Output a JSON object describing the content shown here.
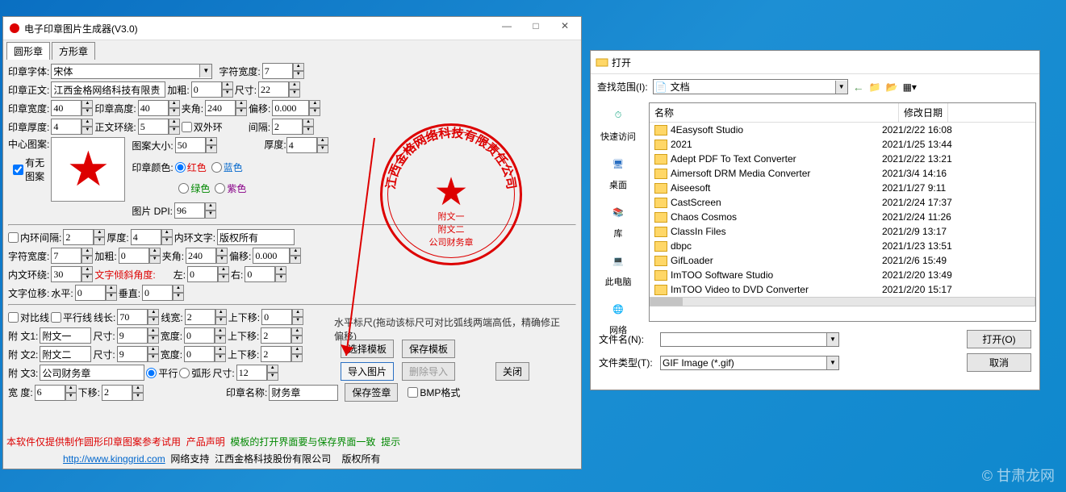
{
  "main": {
    "title": "电子印章图片生成器(V3.0)",
    "tabs": [
      "圆形章",
      "方形章"
    ],
    "font_label": "印章字体:",
    "font": "宋体",
    "charw_label": "字符宽度:",
    "charw": "7",
    "body_label": "印章正文:",
    "body": "江西金格网络科技有限责",
    "bold_label": "加粗:",
    "bold": "0",
    "size_label": "尺寸:",
    "size": "22",
    "w_label": "印章宽度:",
    "w": "40",
    "h_label": "印章高度:",
    "h": "40",
    "angle_label": "夹角:",
    "angle": "240",
    "offset_label": "偏移:",
    "offset": "0.000",
    "thick_label": "印章厚度:",
    "thick": "4",
    "ring_label": "正文环绕:",
    "ring": "5",
    "double_ring": "双外环",
    "gap_label": "间隔:",
    "gap": "2",
    "center_label": "中心图案:",
    "haspat_label": "有无\n图案",
    "pat_size_label": "图案大小:",
    "pat_size": "50",
    "color_label": "印章颜色:",
    "c_red": "红色",
    "c_blue": "蓝色",
    "c_green": "绿色",
    "c_purple": "紫色",
    "dpi_label": "图片 DPI:",
    "dpi": "96",
    "thick2_label": "厚度:",
    "thick2": "4",
    "inner_gap_chk": "内环间隔:",
    "inner_gap": "2",
    "inner_th_label": "厚度:",
    "inner_th": "4",
    "inner_txt_label": "内环文字:",
    "inner_txt": "版权所有",
    "cw_label": "字符宽度:",
    "cw": "7",
    "bold2": "0",
    "angle2": "240",
    "off2": "0.000",
    "iring_label": "内文环绕:",
    "iring": "30",
    "slant_label": "文字倾斜角度:",
    "left_label": "左:",
    "left": "0",
    "right_label": "右:",
    "right": "0",
    "shift_label": "文字位移:",
    "hlabel": "水平:",
    "hv": "0",
    "vlabel": "垂直:",
    "vv": "0",
    "diag": "对比线",
    "para": "平行线",
    "linelen_label": "线长:",
    "linelen": "70",
    "linew_label": "线宽:",
    "linew": "2",
    "up_label": "上下移:",
    "up": "0",
    "a1_label": "附 文1:",
    "a1": "附文一",
    "a1s": "9",
    "a1w": "0",
    "a1u": "2",
    "a2_label": "附 文2:",
    "a2": "附文二",
    "a2s": "9",
    "a2w": "0",
    "a2u": "2",
    "a3_label": "附 文3:",
    "a3": "公司财务章",
    "flat": "平行",
    "arc": "弧形",
    "a3s": "12",
    "deg_label": "宽   度:",
    "deg": "6",
    "down_label": "下移:",
    "down": "2",
    "stamp_name_label": "印章名称:",
    "stamp_name": "财务章",
    "btn_tpl": "选择模板",
    "btn_save_tpl": "保存模板",
    "btn_import": "导入图片",
    "btn_del": "删除导入",
    "btn_close": "关闭",
    "btn_save": "保存签章",
    "bmp_chk": "BMP格式",
    "ruler": "水平标尺(拖动该标尺可对比弧线两端高低，精确修正偏移)",
    "foot1": "本软件仅提供制作圆形印章图案参考试用",
    "foot2": "产品声明",
    "foot3": "模板的打开界面要与保存界面一致",
    "foot4": "提示",
    "foot_url": "http://www.kinggrid.com",
    "foot5": "网络支持",
    "foot6": "江西金格科技股份有限公司",
    "foot7": "版权所有",
    "seal_arc": "江西金格网络科技有限责任公司",
    "seal_l1": "附文一",
    "seal_l2": "附文二",
    "seal_l3": "公司财务章"
  },
  "dlg": {
    "title": "打开",
    "scope_label": "查找范围(I):",
    "scope": "文档",
    "cols": {
      "name": "名称",
      "date": "修改日期"
    },
    "places": [
      "快速访问",
      "桌面",
      "库",
      "此电脑",
      "网络"
    ],
    "rows": [
      {
        "n": "4Easysoft Studio",
        "d": "2021/2/22 16:08"
      },
      {
        "n": "2021",
        "d": "2021/1/25 13:44"
      },
      {
        "n": "Adept PDF To Text Converter",
        "d": "2021/2/22 13:21"
      },
      {
        "n": "Aimersoft DRM Media Converter",
        "d": "2021/3/4 14:16"
      },
      {
        "n": "Aiseesoft",
        "d": "2021/1/27 9:11"
      },
      {
        "n": "CastScreen",
        "d": "2021/2/24 17:37"
      },
      {
        "n": "Chaos Cosmos",
        "d": "2021/2/24 11:26"
      },
      {
        "n": "ClassIn Files",
        "d": "2021/2/9 13:17"
      },
      {
        "n": "dbpc",
        "d": "2021/1/23 13:51"
      },
      {
        "n": "GifLoader",
        "d": "2021/2/6 15:49"
      },
      {
        "n": "ImTOO Software Studio",
        "d": "2021/2/20 13:49"
      },
      {
        "n": "ImTOO Video to DVD Converter",
        "d": "2021/2/20 15:17"
      }
    ],
    "fname_label": "文件名(N):",
    "fname": "",
    "ftype_label": "文件类型(T):",
    "ftype": "GIF Image (*.gif)",
    "open": "打开(O)",
    "cancel": "取消"
  },
  "watermark": "© 甘肃龙网"
}
